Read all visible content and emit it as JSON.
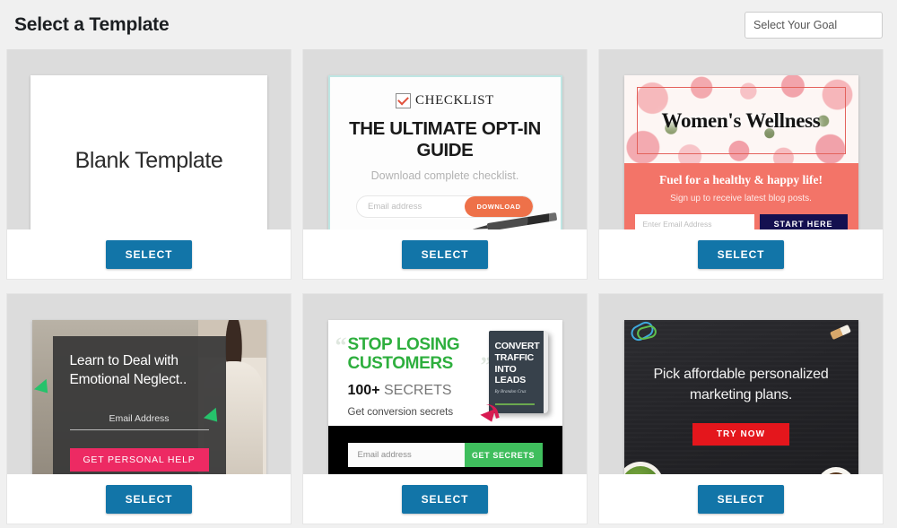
{
  "header": {
    "title": "Select a Template",
    "goal_select_value": "Select Your Goal"
  },
  "common": {
    "select_label": "SELECT"
  },
  "cards": [
    {
      "name": "blank-template",
      "title": "Blank Template",
      "select_label": "SELECT"
    },
    {
      "name": "ultimate-opt-in-guide",
      "badge": "CHECKLIST",
      "headline": "THE ULTIMATE OPT-IN GUIDE",
      "subhead": "Download complete checklist.",
      "email_placeholder": "Email address",
      "cta": "DOWNLOAD",
      "select_label": "SELECT"
    },
    {
      "name": "womens-wellness",
      "headline": "Women's Wellness",
      "tagline": "Fuel for a healthy & happy life!",
      "subhead": "Sign up to receive latest blog posts.",
      "email_placeholder": "Enter Email Address",
      "cta": "START HERE",
      "select_label": "SELECT"
    },
    {
      "name": "emotional-neglect",
      "headline": "Learn to Deal with Emotional Neglect..",
      "email_label": "Email Address",
      "cta": "GET PERSONAL HELP",
      "select_label": "SELECT"
    },
    {
      "name": "stop-losing-customers",
      "headline": "STOP LOSING CUSTOMERS",
      "secrets_count": "100+",
      "secrets_word": "SECRETS",
      "subhead": "Get conversion secrets",
      "book_line1": "CONVERT",
      "book_line2": "TRAFFIC",
      "book_line3": "INTO",
      "book_line4": "LEADS",
      "book_author": "By Brandon Cruz",
      "email_placeholder": "Email address",
      "cta": "GET SECRETS",
      "select_label": "SELECT"
    },
    {
      "name": "marketing-plans",
      "headline": "Pick affordable personalized marketing plans.",
      "cta": "TRY NOW",
      "select_label": "SELECT"
    }
  ],
  "colors": {
    "page_bg": "#f0f0f0",
    "card_preview_bg": "#dcdcdc",
    "select_button": "#1275a8",
    "checklist_accent": "#ee7149",
    "wellness_coral": "#f37468",
    "wellness_navy": "#141050",
    "neglect_pink": "#ed2a63",
    "stop_green": "#2eaf3e",
    "stop_button_green": "#3fbe5d",
    "chalk_red": "#e4161c",
    "arrow_green": "#26c26b",
    "arrow_red": "#d81b52"
  }
}
